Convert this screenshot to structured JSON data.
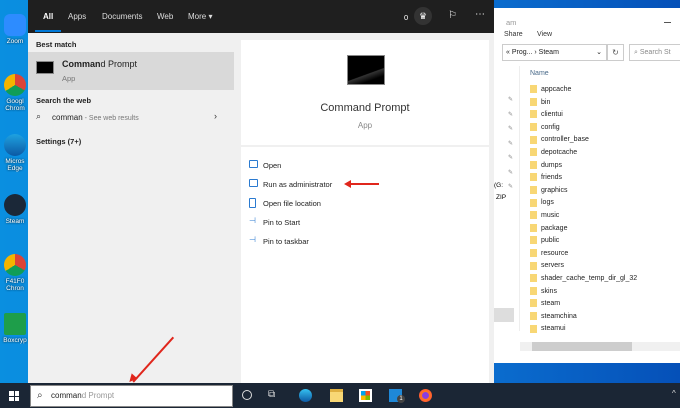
{
  "desktop": {
    "icons": [
      {
        "label": "Zoom"
      },
      {
        "label": "Googl Chrom"
      },
      {
        "label": "Micros Edge"
      },
      {
        "label": "Steam"
      },
      {
        "label": "F41F0 Chron"
      },
      {
        "label": "Boxcryp"
      }
    ]
  },
  "start": {
    "tabs": [
      "All",
      "Apps",
      "Documents",
      "Web",
      "More"
    ],
    "points": "0",
    "best_match_heading": "Best match",
    "best_match": {
      "title_bold": "Comman",
      "title_rest": "d Prompt",
      "subtitle": "App"
    },
    "web_heading": "Search the web",
    "web_query": "comman",
    "web_suffix": " - See web results",
    "settings": "Settings (7+)",
    "preview": {
      "title": "Command Prompt",
      "subtitle": "App"
    },
    "actions": [
      "Open",
      "Run as administrator",
      "Open file location",
      "Pin to Start",
      "Pin to taskbar"
    ]
  },
  "explorer": {
    "title": "am",
    "ribbon": [
      "Share",
      "View"
    ],
    "address": "« Prog... › Steam",
    "search_placeholder": "Search St",
    "column": "Name",
    "nav": [
      "(G:",
      "ZIP"
    ],
    "files": [
      "appcache",
      "bin",
      "clientui",
      "config",
      "controller_base",
      "depotcache",
      "dumps",
      "friends",
      "graphics",
      "logs",
      "music",
      "package",
      "public",
      "resource",
      "servers",
      "shader_cache_temp_dir_gl_32",
      "skins",
      "steam",
      "steamchina",
      "steamui"
    ]
  },
  "taskbar": {
    "typed": "comman",
    "completion": "d Prompt",
    "mail_badge": "1"
  }
}
